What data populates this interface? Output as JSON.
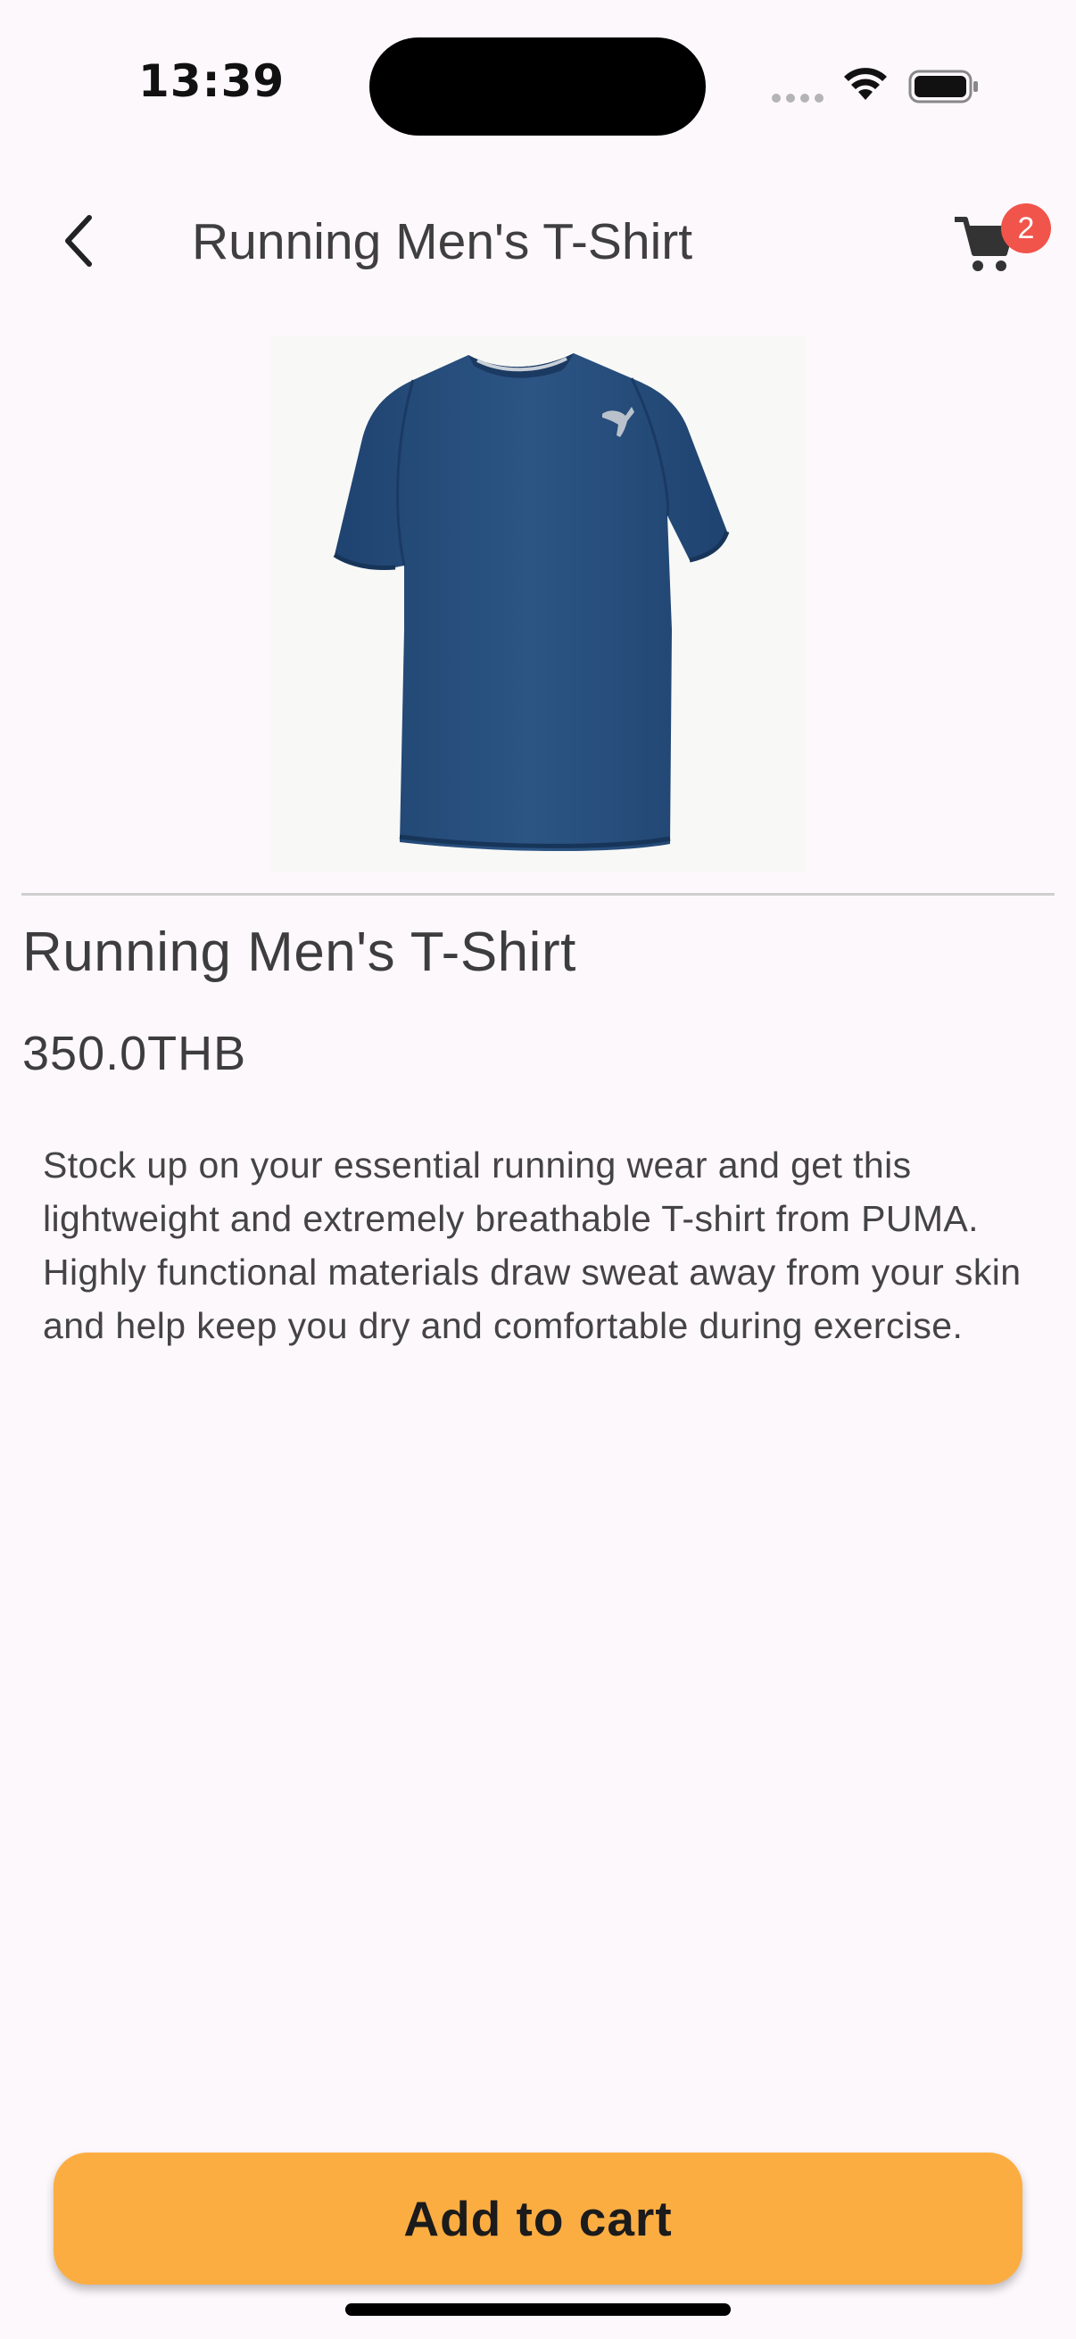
{
  "status_bar": {
    "time": "13:39"
  },
  "app_bar": {
    "title": "Running Men's T-Shirt",
    "cart_count": "2"
  },
  "product": {
    "name": "Running Men's T-Shirt",
    "price": "350.0THB",
    "description": "Stock up on your essential running wear and get this lightweight and extremely breathable T-shirt from PUMA. Highly functional materials draw sweat away from your skin and help keep you dry and comfortable during exercise.",
    "image_icon": "tshirt-image",
    "shirt_color": "#284f7c"
  },
  "actions": {
    "add_to_cart_label": "Add to cart"
  },
  "colors": {
    "accent": "#fcad42",
    "badge": "#f1544a",
    "background": "#fdf8fc"
  }
}
